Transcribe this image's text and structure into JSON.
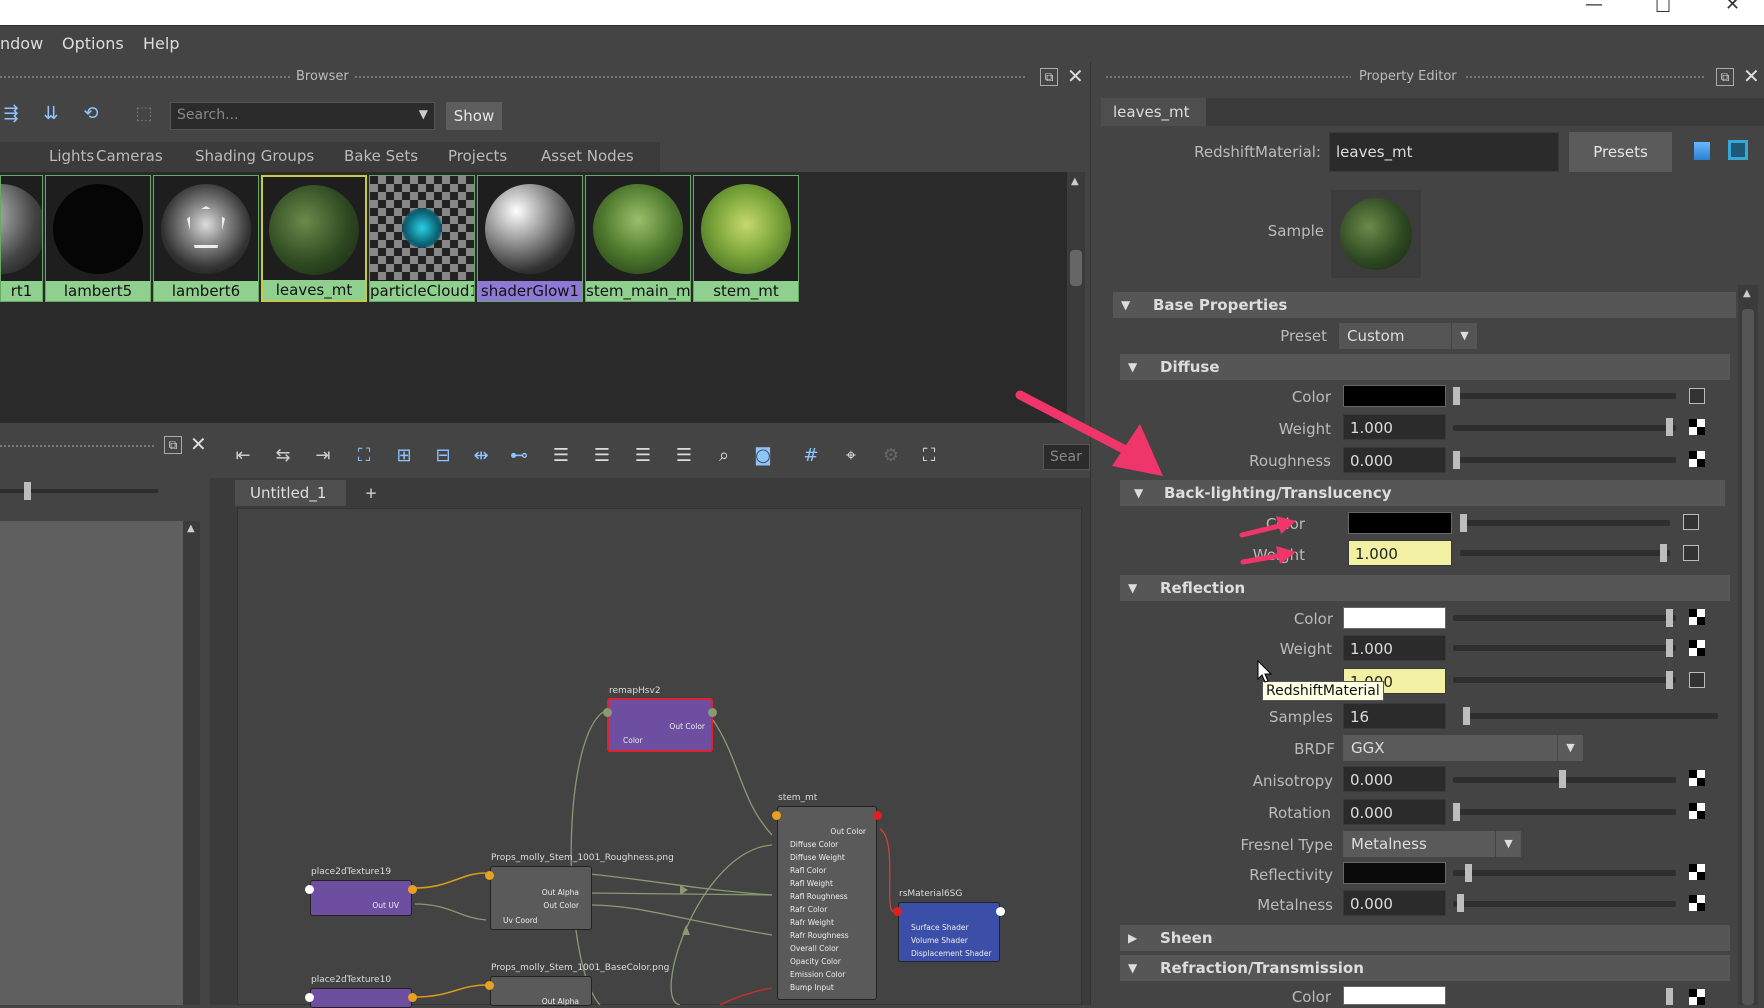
{
  "menubar": {
    "items": [
      "ndow",
      "Options",
      "Help"
    ]
  },
  "browser": {
    "title": "Browser",
    "search_placeholder": "Search...",
    "show_label": "Show",
    "tabs": [
      "Lights",
      "Cameras",
      "Shading Groups",
      "Bake Sets",
      "Projects",
      "Asset Nodes"
    ],
    "swatches": [
      "rt1",
      "lambert5",
      "lambert6",
      "leaves_mt",
      "particleCloud1",
      "shaderGlow1",
      "stem_main_mt",
      "stem_mt"
    ],
    "selected_swatch": "leaves_mt"
  },
  "node_editor": {
    "tabs": [
      "Untitled_1",
      "+"
    ],
    "search_placeholder": "Sear",
    "nodes": {
      "remap": {
        "title": "remapHsv2",
        "ports": [
          "Out Color",
          "Color"
        ]
      },
      "stem": {
        "title": "stem_mt",
        "ports": [
          "Out Color",
          "Diffuse Color",
          "Diffuse Weight",
          "Rafl Color",
          "Rafl Weight",
          "Rafl Roughness",
          "Rafr Color",
          "Rafr Weight",
          "Rafr Roughness",
          "Overall Color",
          "Opacity Color",
          "Emission Color",
          "Bump Input"
        ]
      },
      "rsMat": {
        "title": "rsMaterial6SG",
        "ports": [
          "Surface Shader",
          "Volume Shader",
          "Displacement Shader"
        ]
      },
      "p2d19": {
        "title": "place2dTexture19",
        "ports": [
          "Out UV"
        ]
      },
      "rough": {
        "title": "Props_molly_Stem_1001_Roughness.png",
        "ports": [
          "Out Alpha",
          "Out Color",
          "Uv Coord"
        ]
      },
      "p2d10": {
        "title": "place2dTexture10"
      },
      "base": {
        "title": "Props_molly_Stem_1001_BaseColor.png",
        "ports": [
          "Out Alpha"
        ]
      }
    }
  },
  "property_editor": {
    "title": "Property Editor",
    "tab": "leaves_mt",
    "material_label": "RedshiftMaterial:",
    "material_name": "leaves_mt",
    "presets_label": "Presets",
    "sample_label": "Sample",
    "sections": {
      "base": "Base Properties",
      "diffuse": "Diffuse",
      "backlight": "Back-lighting/Translucency",
      "reflection": "Reflection",
      "sheen": "Sheen",
      "refraction": "Refraction/Transmission"
    },
    "preset_label": "Preset",
    "preset_value": "Custom",
    "diffuse": {
      "color_label": "Color",
      "weight_label": "Weight",
      "weight": "1.000",
      "roughness_label": "Roughness",
      "roughness": "0.000"
    },
    "backlight": {
      "color_label": "Color",
      "weight_label": "Weight",
      "weight": "1.000"
    },
    "reflection": {
      "color_label": "Color",
      "weight_label": "Weight",
      "weight": "1.000",
      "roughness_partial": "1.000",
      "samples_label": "Samples",
      "samples": "16",
      "brdf_label": "BRDF",
      "brdf": "GGX",
      "aniso_label": "Anisotropy",
      "aniso": "0.000",
      "rotation_label": "Rotation",
      "rotation": "0.000",
      "fresnel_label": "Fresnel Type",
      "fresnel": "Metalness",
      "reflectivity_label": "Reflectivity",
      "metalness_label": "Metalness",
      "metalness": "0.000"
    },
    "refraction": {
      "color_label": "Color"
    },
    "tooltip": "RedshiftMaterial"
  },
  "colors": {
    "accent_arrow": "#f0356b",
    "highlight_field": "#f2f0a2",
    "swatch_label": "#8fd08f",
    "selected_swatch": "#c8c84a"
  }
}
